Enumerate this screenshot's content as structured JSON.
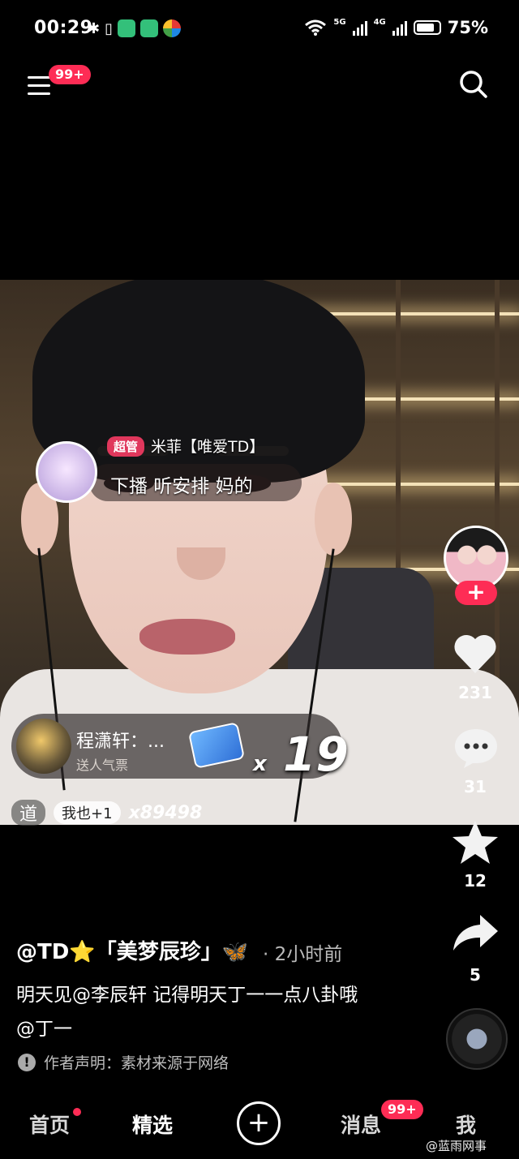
{
  "status_bar": {
    "time": "00:29",
    "net1": "5G",
    "net2": "4G",
    "battery": "75%",
    "battery_level": 0.75
  },
  "top_bar": {
    "menu_badge": "99+",
    "menu_icon": "hamburger-icon",
    "search_icon": "search-icon"
  },
  "video": {
    "comment": {
      "role_tag": "超管",
      "username": "米菲【唯爱TD】",
      "text": "下播 听安排 妈的"
    },
    "gift": {
      "user": "程潇轩：...",
      "action": "送人气票",
      "count": "19",
      "count_prefix": "x"
    },
    "combo": {
      "prefix": "道",
      "button": "我也+1",
      "count": "x89498"
    }
  },
  "right_rail": {
    "likes": "231",
    "comments": "31",
    "favorites": "12",
    "shares": "5",
    "follow_label": "+"
  },
  "caption": {
    "author": "@TD⭐「美梦辰珍」🦋",
    "time": "· 2小时前",
    "text": "明天见@李辰轩 记得明天丁一一点八卦哦 @丁一",
    "declaration": "作者声明：素材来源于网络",
    "declaration_icon": "!"
  },
  "bottom_nav": {
    "home": "首页",
    "featured": "精选",
    "add": "+",
    "messages": "消息",
    "messages_badge": "99+",
    "me": "我",
    "watermark": "@蓝雨网事"
  },
  "colors": {
    "accent": "#fe2c55",
    "background": "#000000"
  }
}
